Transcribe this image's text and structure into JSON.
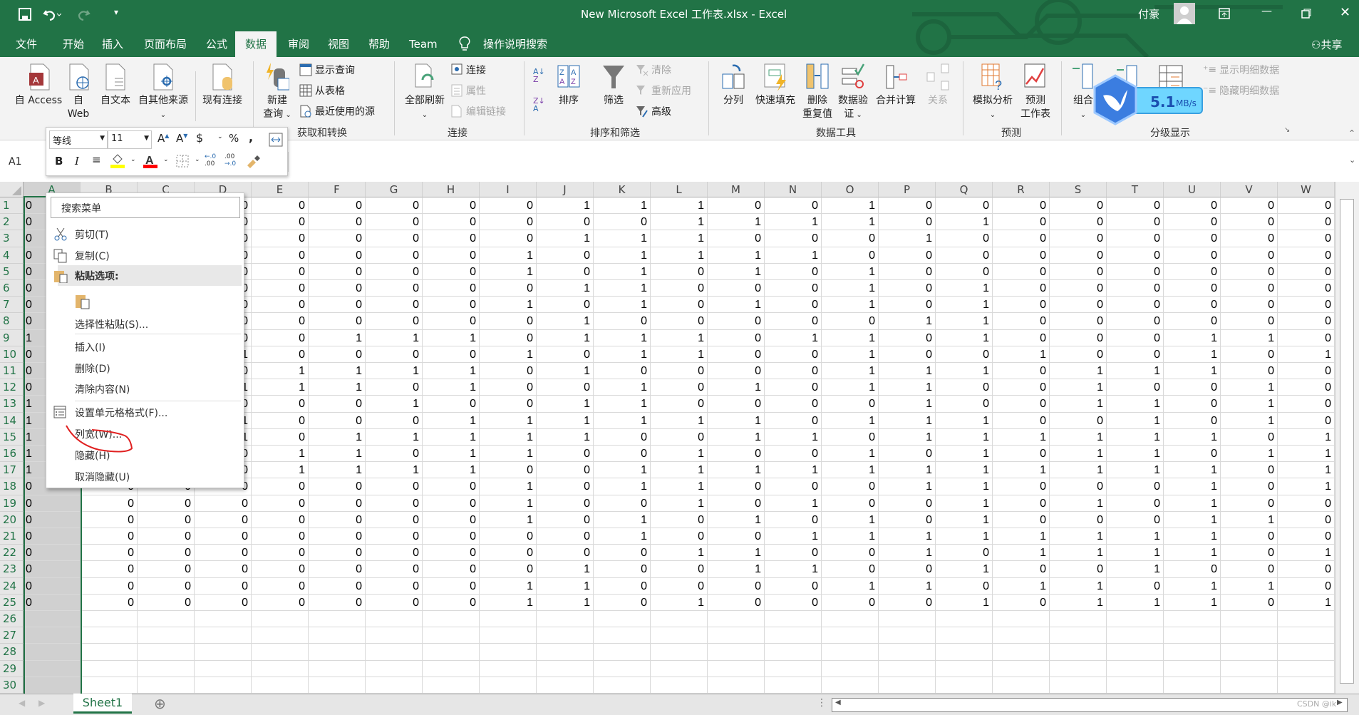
{
  "titlebar": {
    "title": "New Microsoft Excel 工作表.xlsx  -  Excel",
    "user": "付豪",
    "share": "共享"
  },
  "tabs": [
    {
      "label": "文件"
    },
    {
      "label": "开始"
    },
    {
      "label": "插入"
    },
    {
      "label": "页面布局"
    },
    {
      "label": "公式"
    },
    {
      "label": "数据",
      "active": true
    },
    {
      "label": "审阅"
    },
    {
      "label": "视图"
    },
    {
      "label": "帮助"
    },
    {
      "label": "Team"
    }
  ],
  "tell_me": "操作说明搜索",
  "ribbon": {
    "get_external": {
      "access": "自 Access",
      "web1": "自",
      "web2": "Web",
      "text": "自文本",
      "other": "自其他来源",
      "existing": "现有连接"
    },
    "get_transform": {
      "label": "获取和转换",
      "new_query1": "新建",
      "new_query2": "查询",
      "show_queries": "显示查询",
      "from_table": "从表格",
      "recent_sources": "最近使用的源"
    },
    "connections": {
      "label": "连接",
      "refresh_all": "全部刷新",
      "connections": "连接",
      "properties": "属性",
      "edit_links": "编辑链接"
    },
    "sort_filter": {
      "label": "排序和筛选",
      "sort": "排序",
      "filter": "筛选",
      "clear": "清除",
      "reapply": "重新应用",
      "advanced": "高级"
    },
    "data_tools": {
      "label": "数据工具",
      "text_to_columns": "分列",
      "flash_fill": "快速填充",
      "remove_dup1": "删除",
      "remove_dup2": "重复值",
      "validation1": "数据验",
      "validation2": "证",
      "consolidate": "合并计算",
      "relationships": "关系"
    },
    "forecast": {
      "label": "预测",
      "what_if": "模拟分析",
      "forecast1": "预测",
      "forecast2": "工作表"
    },
    "outline": {
      "label": "分级显示",
      "group": "组合",
      "show_detail": "显示明细数据",
      "hide_detail": "隐藏明细数据"
    }
  },
  "speed_widget": {
    "value": "5.1",
    "unit": "MB/s"
  },
  "namebox": "A1",
  "mini_toolbar": {
    "font": "等线",
    "size": "11",
    "fill_color": "#ffff00",
    "font_color": "#ff0000"
  },
  "context_menu": {
    "search": "搜索菜单",
    "items": [
      {
        "label": "剪切(T)",
        "icon": "scissors-icon"
      },
      {
        "label": "复制(C)",
        "icon": "copy-icon"
      },
      {
        "label": "粘贴选项:",
        "icon": "paste-icon"
      },
      {
        "label": "选择性粘贴(S)..."
      },
      {
        "label": "插入(I)"
      },
      {
        "label": "删除(D)"
      },
      {
        "label": "清除内容(N)"
      },
      {
        "label": "设置单元格格式(F)...",
        "icon": "format-cells-icon"
      },
      {
        "label": "列宽(W)...",
        "annotated": true
      },
      {
        "label": "隐藏(H)"
      },
      {
        "label": "取消隐藏(U)"
      }
    ]
  },
  "annotation_color": "#e02020",
  "accent": "#217346",
  "sheet": {
    "columns": [
      "A",
      "B",
      "C",
      "D",
      "E",
      "F",
      "G",
      "H",
      "I",
      "J",
      "K",
      "L",
      "M",
      "N",
      "O",
      "P",
      "Q",
      "R",
      "S",
      "T",
      "U",
      "V",
      "W"
    ],
    "row_count": 30,
    "selected_column": "A",
    "rows": [
      [
        "0",
        "",
        "",
        "0",
        "0",
        "0",
        "0",
        "0",
        "0",
        "1",
        "1",
        "1",
        "0",
        "0",
        "1",
        "0",
        "0",
        "0",
        "0",
        "0",
        "0",
        "0",
        "0"
      ],
      [
        "0",
        "",
        "",
        "0",
        "0",
        "0",
        "0",
        "0",
        "0",
        "0",
        "0",
        "1",
        "1",
        "1",
        "1",
        "0",
        "1",
        "0",
        "0",
        "0",
        "0",
        "0",
        "0"
      ],
      [
        "0",
        "",
        "",
        "0",
        "0",
        "0",
        "0",
        "0",
        "0",
        "1",
        "1",
        "1",
        "0",
        "0",
        "0",
        "1",
        "0",
        "0",
        "0",
        "0",
        "0",
        "0",
        "0"
      ],
      [
        "0",
        "",
        "",
        "0",
        "0",
        "0",
        "0",
        "0",
        "1",
        "0",
        "1",
        "1",
        "1",
        "1",
        "0",
        "0",
        "0",
        "0",
        "0",
        "0",
        "0",
        "0",
        "0"
      ],
      [
        "0",
        "",
        "",
        "0",
        "0",
        "0",
        "0",
        "0",
        "1",
        "0",
        "1",
        "0",
        "1",
        "0",
        "1",
        "0",
        "0",
        "0",
        "0",
        "0",
        "0",
        "0",
        "0"
      ],
      [
        "0",
        "",
        "",
        "0",
        "0",
        "0",
        "0",
        "0",
        "0",
        "1",
        "1",
        "0",
        "0",
        "0",
        "1",
        "0",
        "1",
        "0",
        "0",
        "0",
        "0",
        "0",
        "0"
      ],
      [
        "0",
        "",
        "",
        "0",
        "0",
        "0",
        "0",
        "0",
        "1",
        "0",
        "1",
        "0",
        "1",
        "0",
        "1",
        "0",
        "1",
        "0",
        "0",
        "0",
        "0",
        "0",
        "0"
      ],
      [
        "0",
        "",
        "",
        "0",
        "0",
        "0",
        "0",
        "0",
        "0",
        "1",
        "0",
        "0",
        "0",
        "0",
        "0",
        "1",
        "1",
        "0",
        "0",
        "0",
        "0",
        "0",
        "0"
      ],
      [
        "1",
        "",
        "",
        "0",
        "0",
        "1",
        "1",
        "1",
        "0",
        "1",
        "1",
        "1",
        "0",
        "1",
        "1",
        "0",
        "1",
        "0",
        "0",
        "0",
        "1",
        "1",
        "0"
      ],
      [
        "0",
        "",
        "",
        "1",
        "0",
        "0",
        "0",
        "0",
        "1",
        "0",
        "1",
        "1",
        "0",
        "0",
        "1",
        "0",
        "0",
        "1",
        "0",
        "0",
        "1",
        "0",
        "1"
      ],
      [
        "0",
        "",
        "",
        "0",
        "1",
        "1",
        "1",
        "1",
        "0",
        "1",
        "0",
        "0",
        "0",
        "0",
        "1",
        "1",
        "1",
        "0",
        "1",
        "1",
        "1",
        "0",
        "0"
      ],
      [
        "0",
        "",
        "",
        "1",
        "1",
        "1",
        "0",
        "1",
        "0",
        "0",
        "1",
        "0",
        "1",
        "0",
        "1",
        "1",
        "0",
        "0",
        "1",
        "0",
        "0",
        "1",
        "0"
      ],
      [
        "1",
        "",
        "",
        "0",
        "0",
        "0",
        "1",
        "0",
        "0",
        "1",
        "1",
        "0",
        "0",
        "0",
        "0",
        "1",
        "0",
        "0",
        "1",
        "1",
        "0",
        "1",
        "0"
      ],
      [
        "1",
        "",
        "",
        "1",
        "0",
        "0",
        "0",
        "1",
        "1",
        "1",
        "1",
        "1",
        "1",
        "0",
        "1",
        "1",
        "1",
        "0",
        "0",
        "1",
        "0",
        "1",
        "0"
      ],
      [
        "1",
        "",
        "",
        "1",
        "0",
        "1",
        "1",
        "1",
        "1",
        "1",
        "0",
        "0",
        "1",
        "1",
        "0",
        "1",
        "1",
        "1",
        "1",
        "1",
        "1",
        "0",
        "1"
      ],
      [
        "1",
        "",
        "",
        "0",
        "1",
        "1",
        "0",
        "1",
        "1",
        "0",
        "0",
        "1",
        "0",
        "0",
        "1",
        "0",
        "1",
        "0",
        "1",
        "1",
        "0",
        "1",
        "1"
      ],
      [
        "1",
        "",
        "",
        "0",
        "1",
        "1",
        "1",
        "1",
        "0",
        "0",
        "1",
        "1",
        "1",
        "1",
        "1",
        "1",
        "1",
        "1",
        "1",
        "1",
        "1",
        "0",
        "1"
      ],
      [
        "0",
        "0",
        "0",
        "0",
        "0",
        "0",
        "0",
        "0",
        "1",
        "0",
        "1",
        "1",
        "0",
        "0",
        "0",
        "1",
        "1",
        "0",
        "0",
        "0",
        "1",
        "0",
        "1"
      ],
      [
        "0",
        "0",
        "0",
        "0",
        "0",
        "0",
        "0",
        "0",
        "1",
        "0",
        "0",
        "1",
        "0",
        "1",
        "0",
        "0",
        "1",
        "0",
        "1",
        "0",
        "1",
        "0",
        "0"
      ],
      [
        "0",
        "0",
        "0",
        "0",
        "0",
        "0",
        "0",
        "0",
        "1",
        "0",
        "1",
        "0",
        "1",
        "0",
        "1",
        "0",
        "1",
        "0",
        "0",
        "0",
        "1",
        "1",
        "0"
      ],
      [
        "0",
        "0",
        "0",
        "0",
        "0",
        "0",
        "0",
        "0",
        "0",
        "0",
        "1",
        "0",
        "0",
        "1",
        "1",
        "1",
        "1",
        "1",
        "1",
        "1",
        "1",
        "0",
        "0"
      ],
      [
        "0",
        "0",
        "0",
        "0",
        "0",
        "0",
        "0",
        "0",
        "0",
        "0",
        "0",
        "1",
        "1",
        "0",
        "0",
        "1",
        "0",
        "1",
        "1",
        "1",
        "1",
        "0",
        "1"
      ],
      [
        "0",
        "0",
        "0",
        "0",
        "0",
        "0",
        "0",
        "0",
        "0",
        "1",
        "0",
        "0",
        "1",
        "1",
        "0",
        "0",
        "1",
        "0",
        "0",
        "1",
        "0",
        "0",
        "0"
      ],
      [
        "0",
        "0",
        "0",
        "0",
        "0",
        "0",
        "0",
        "0",
        "1",
        "1",
        "0",
        "0",
        "0",
        "0",
        "1",
        "1",
        "0",
        "1",
        "1",
        "0",
        "1",
        "1",
        "0"
      ],
      [
        "0",
        "0",
        "0",
        "0",
        "0",
        "0",
        "0",
        "0",
        "1",
        "1",
        "0",
        "1",
        "0",
        "0",
        "0",
        "0",
        "1",
        "0",
        "1",
        "1",
        "1",
        "0",
        "1"
      ]
    ]
  },
  "sheet_tabs": [
    {
      "label": "Sheet1",
      "active": true
    }
  ],
  "watermark": "CSDN @ik"
}
